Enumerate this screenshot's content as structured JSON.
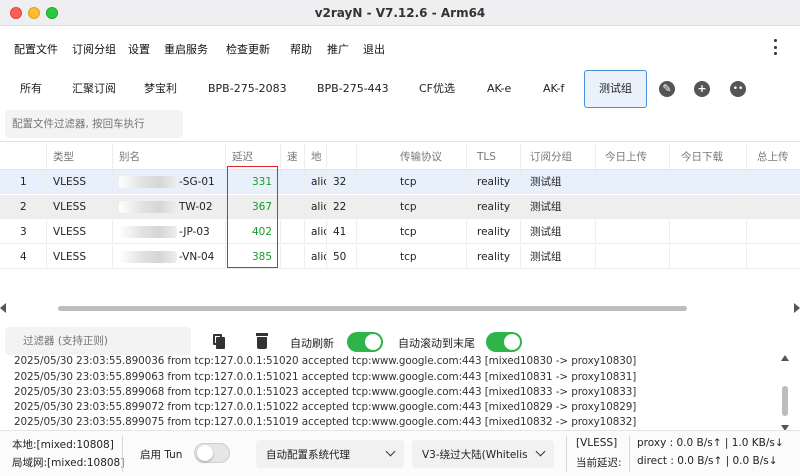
{
  "window": {
    "title": "v2rayN - V7.12.6 - Arm64"
  },
  "menu": [
    "配置文件",
    "订阅分组",
    "设置",
    "重启服务",
    "检查更新",
    "帮助",
    "推广",
    "退出"
  ],
  "tabs": [
    "所有",
    "汇聚订阅",
    "梦宝利",
    "BPB-275-2083",
    "BPB-275-443",
    "CF优选",
    "AK-e",
    "AK-f",
    "测试组"
  ],
  "active_tab": "测试组",
  "profile_filter": {
    "placeholder": "配置文件过滤器, 按回车执行"
  },
  "table": {
    "columns": [
      "类型",
      "别名",
      "延迟",
      "速",
      "地",
      "传输协议",
      "TLS",
      "订阅分组",
      "今日上传",
      "今日下载",
      "总上传"
    ],
    "rows": [
      {
        "idx": "1",
        "type": "VLESS",
        "alias": "-SG-01",
        "latency": "331",
        "address": "alic",
        "port": "32",
        "network": "tcp",
        "tls": "reality",
        "group": "测试组"
      },
      {
        "idx": "2",
        "type": "VLESS",
        "alias": "TW-02",
        "latency": "367",
        "address": "alic",
        "port": "22",
        "network": "tcp",
        "tls": "reality",
        "group": "测试组"
      },
      {
        "idx": "3",
        "type": "VLESS",
        "alias": "-JP-03",
        "latency": "402",
        "address": "alic",
        "port": "41",
        "network": "tcp",
        "tls": "reality",
        "group": "测试组"
      },
      {
        "idx": "4",
        "type": "VLESS",
        "alias": "-VN-04",
        "latency": "385",
        "address": "alic",
        "port": "50",
        "network": "tcp",
        "tls": "reality",
        "group": "测试组"
      }
    ]
  },
  "log_toolbar": {
    "filter_placeholder": "过滤器 (支持正则)",
    "auto_refresh_label": "自动刷新",
    "auto_refresh": true,
    "auto_scroll_label": "自动滚动到末尾",
    "auto_scroll": true
  },
  "log_lines": [
    "2025/05/30 23:03:55.890036 from tcp:127.0.0.1:51020 accepted tcp:www.google.com:443 [mixed10830 -> proxy10830]",
    "2025/05/30 23:03:55.899063 from tcp:127.0.0.1:51021 accepted tcp:www.google.com:443 [mixed10831 -> proxy10831]",
    "2025/05/30 23:03:55.899068 from tcp:127.0.0.1:51023 accepted tcp:www.google.com:443 [mixed10833 -> proxy10833]",
    "2025/05/30 23:03:55.899072 from tcp:127.0.0.1:51022 accepted tcp:www.google.com:443 [mixed10829 -> proxy10829]",
    "2025/05/30 23:03:55.899075 from tcp:127.0.0.1:51019 accepted tcp:www.google.com:443 [mixed10832 -> proxy10832]"
  ],
  "status": {
    "local": "本地:[mixed:10808]",
    "lan": "局域网:[mixed:10808]",
    "tun_label": "启用 Tun",
    "tun_enabled": false,
    "sysproxy": "自动配置系统代理",
    "routing": "V3-绕过大陆(Whitelis",
    "server": "[VLESS] ",
    "latency": "当前延迟:",
    "proxy_speed": "proxy : 0.0 B/s↑ | 1.0 KB/s↓",
    "direct_speed": "direct : 0.0 B/s↑ | 0.0 B/s↓"
  },
  "colors": {
    "accent": "#4a90d9",
    "toggle_on": "#2fb44a",
    "latency": "#1a9b2a",
    "highlight": "#e0262b"
  }
}
